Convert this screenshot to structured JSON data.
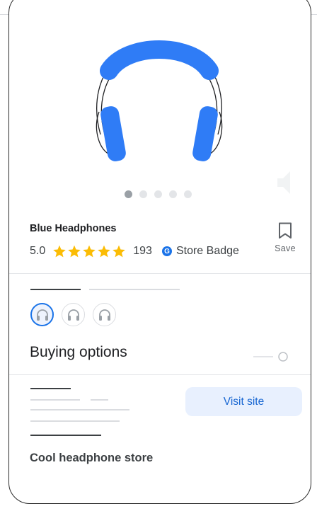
{
  "product": {
    "name": "Blue Headphones",
    "rating": "5.0",
    "review_count": "193",
    "store_badge_label": "Store Badge",
    "badge_letter": "G",
    "save_label": "Save",
    "image_count": 5,
    "active_image_index": 0
  },
  "variants": {
    "icons": [
      "headphones-icon",
      "headphones-icon",
      "headphones-icon"
    ],
    "selected_index": 0
  },
  "buying": {
    "title": "Buying options",
    "visit_label": "Visit site",
    "store_name": "Cool headphone store"
  },
  "colors": {
    "product_blue": "#2f7cf6",
    "accent_blue": "#1a73e8",
    "star_yellow": "#fbbc04",
    "button_bg": "#e8f0fe"
  }
}
